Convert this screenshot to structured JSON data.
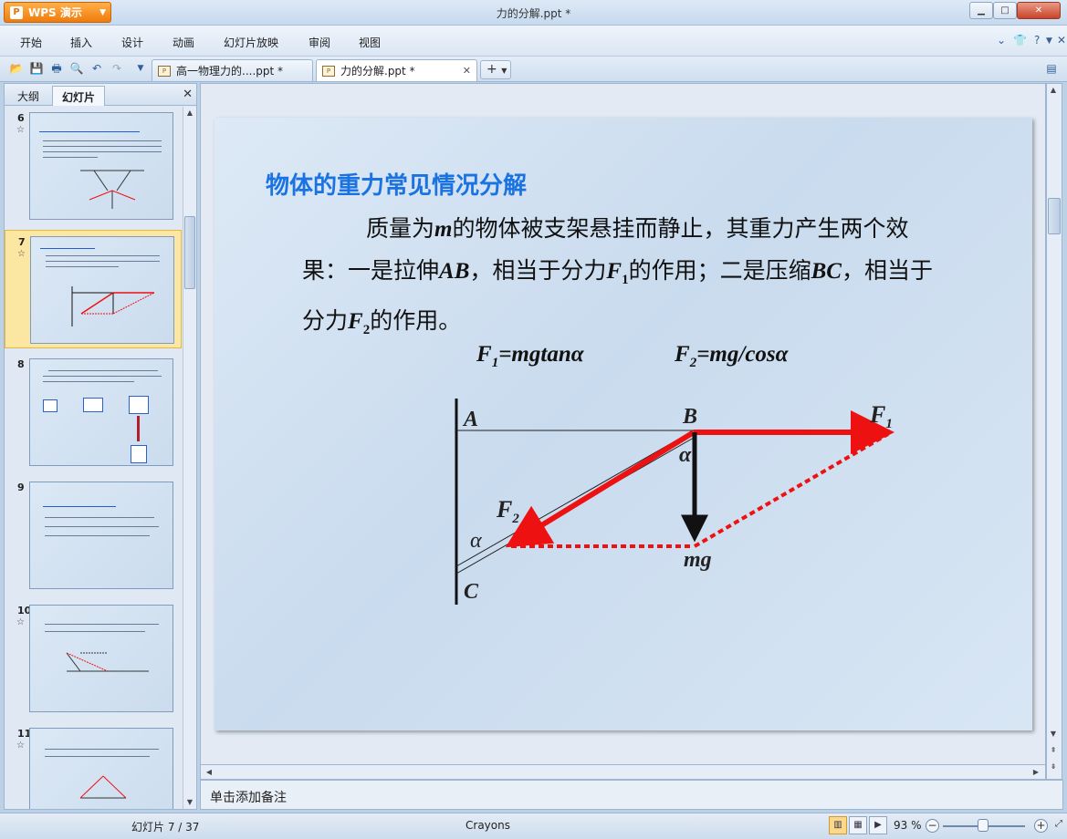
{
  "app": {
    "name": "WPS 演示",
    "window_title": "力的分解.ppt *"
  },
  "menu": [
    "开始",
    "插入",
    "设计",
    "动画",
    "幻灯片放映",
    "审阅",
    "视图"
  ],
  "doc_tabs": [
    {
      "label": "高一物理力的....ppt *"
    },
    {
      "label": "力的分解.ppt *"
    }
  ],
  "left_panel": {
    "tab_outline": "大纲",
    "tab_slides": "幻灯片",
    "thumbnails": [
      {
        "num": "6",
        "star": "☆"
      },
      {
        "num": "7",
        "star": "☆"
      },
      {
        "num": "8",
        "star": ""
      },
      {
        "num": "9",
        "star": ""
      },
      {
        "num": "10",
        "star": "☆"
      },
      {
        "num": "11",
        "star": "☆"
      }
    ]
  },
  "slide": {
    "title": "物体的重力常见情况分解",
    "p1_a": "质量为",
    "p1_m": "m",
    "p1_b": "的物体被支架悬挂而静止，其重力产生两个效果：一是拉伸",
    "p1_ab": "AB",
    "p1_c": "，相当于分力",
    "p1_f1": "F",
    "p1_f1sub": "1",
    "p1_d": "的作用；二是压缩",
    "p1_bc": "BC",
    "p1_e": "，相当于分力",
    "p1_f2": "F",
    "p1_f2sub": "2",
    "p1_f": "的作用。",
    "formula1_lhs": "F",
    "formula1_sub": "1",
    "formula1_rhs": "=mgtanα",
    "formula2_lhs": "F",
    "formula2_sub": "2",
    "formula2_rhs": "=mg/cosα",
    "labels": {
      "A": "A",
      "B": "B",
      "C": "C",
      "F1": "F",
      "F1sub": "1",
      "F2": "F",
      "F2sub": "2",
      "alpha_top": "α",
      "alpha_bottom": "α",
      "mg": "mg"
    }
  },
  "notes_placeholder": "单击添加备注",
  "status": {
    "slide_counter": "幻灯片 7 / 37",
    "theme": "Crayons",
    "zoom": "93 %"
  },
  "colors": {
    "title_blue": "#1a73e0",
    "force_red": "#ee1111",
    "app_orange": "#f07b0c"
  }
}
